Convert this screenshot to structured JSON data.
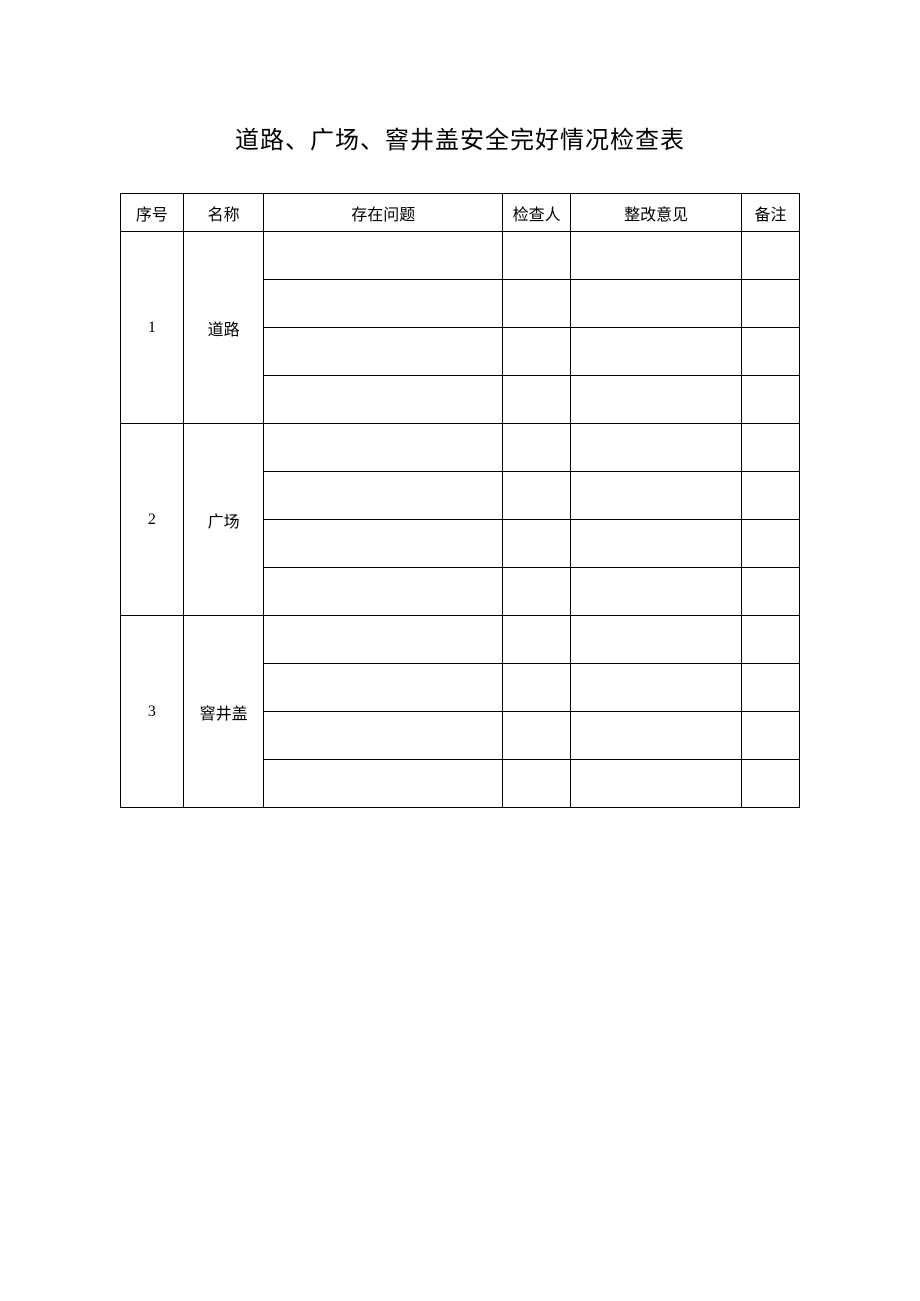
{
  "title": "道路、广场、窨井盖安全完好情况检查表",
  "headers": {
    "seq": "序号",
    "name": "名称",
    "issue": "存在问题",
    "inspector": "检查人",
    "opinion": "整改意见",
    "remark": "备注"
  },
  "rows": [
    {
      "seq": "1",
      "name": "道路"
    },
    {
      "seq": "2",
      "name": "广场"
    },
    {
      "seq": "3",
      "name": "窨井盖"
    }
  ]
}
